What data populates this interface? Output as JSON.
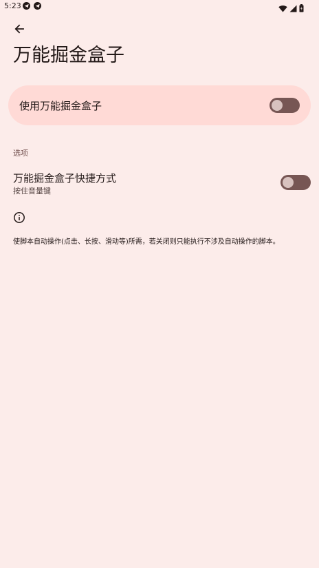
{
  "status_bar": {
    "time": "5:23",
    "left_icons": [
      "telegram-icon",
      "telegram-icon"
    ],
    "right_icons": [
      "wifi-icon",
      "signal-icon",
      "battery-icon"
    ]
  },
  "header": {
    "back_icon": "arrow-back-icon",
    "title": "万能掘金盒子"
  },
  "main_toggle": {
    "label": "使用万能掘金盒子",
    "enabled": false
  },
  "options": {
    "section_title": "选项",
    "items": [
      {
        "title": "万能掘金盒子快捷方式",
        "subtitle": "按住音量键",
        "enabled": false
      }
    ]
  },
  "info": {
    "icon": "info-icon",
    "text": "使脚本自动操作(点击、长按、滑动等)所需，若关闭则只能执行不涉及自动操作的脚本。"
  },
  "colors": {
    "background": "#fcecea",
    "card": "#ffdad6",
    "switch_track": "#775654",
    "switch_thumb": "#d8c2bf",
    "accent_text": "#775654"
  }
}
